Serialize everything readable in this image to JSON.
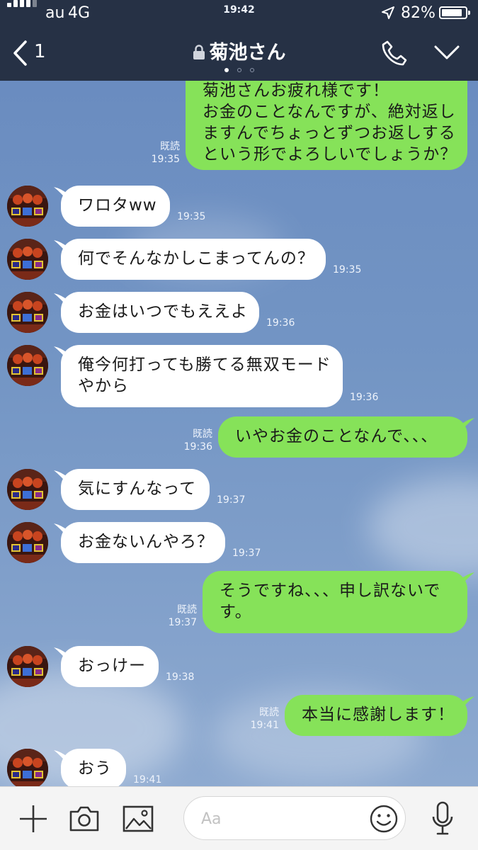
{
  "status": {
    "carrier": "au",
    "network": "4G",
    "time": "19:42",
    "battery": "82%"
  },
  "header": {
    "back_count": "1",
    "title": "菊池さん"
  },
  "input": {
    "placeholder": "Aa"
  },
  "messages": [
    {
      "side": "out",
      "text": "菊池さんお疲れ様です！\nお金のことなんですが、絶対返し\nますんでちょっとずつお返しする\nという形でよろしいでしょうか？",
      "read": "既読",
      "time": "19:35"
    },
    {
      "side": "in",
      "text": "ワロタww",
      "time": "19:35"
    },
    {
      "side": "in",
      "text": "何でそんなかしこまってんの？",
      "time": "19:35"
    },
    {
      "side": "in",
      "text": "お金はいつでもええよ",
      "time": "19:36"
    },
    {
      "side": "in",
      "text": "俺今何打っても勝てる無双モード\nやから",
      "time": "19:36"
    },
    {
      "side": "out",
      "text": "いやお金のことなんで、、、",
      "read": "既読",
      "time": "19:36"
    },
    {
      "side": "in",
      "text": "気にすんなって",
      "time": "19:37"
    },
    {
      "side": "in",
      "text": "お金ないんやろ？",
      "time": "19:37"
    },
    {
      "side": "out",
      "text": "そうですね、、、申し訳ないで\nす。",
      "read": "既読",
      "time": "19:37"
    },
    {
      "side": "in",
      "text": "おっけー",
      "time": "19:38"
    },
    {
      "side": "out",
      "text": "本当に感謝します！",
      "read": "既読",
      "time": "19:41"
    },
    {
      "side": "in",
      "text": "おう",
      "time": "19:41"
    }
  ]
}
